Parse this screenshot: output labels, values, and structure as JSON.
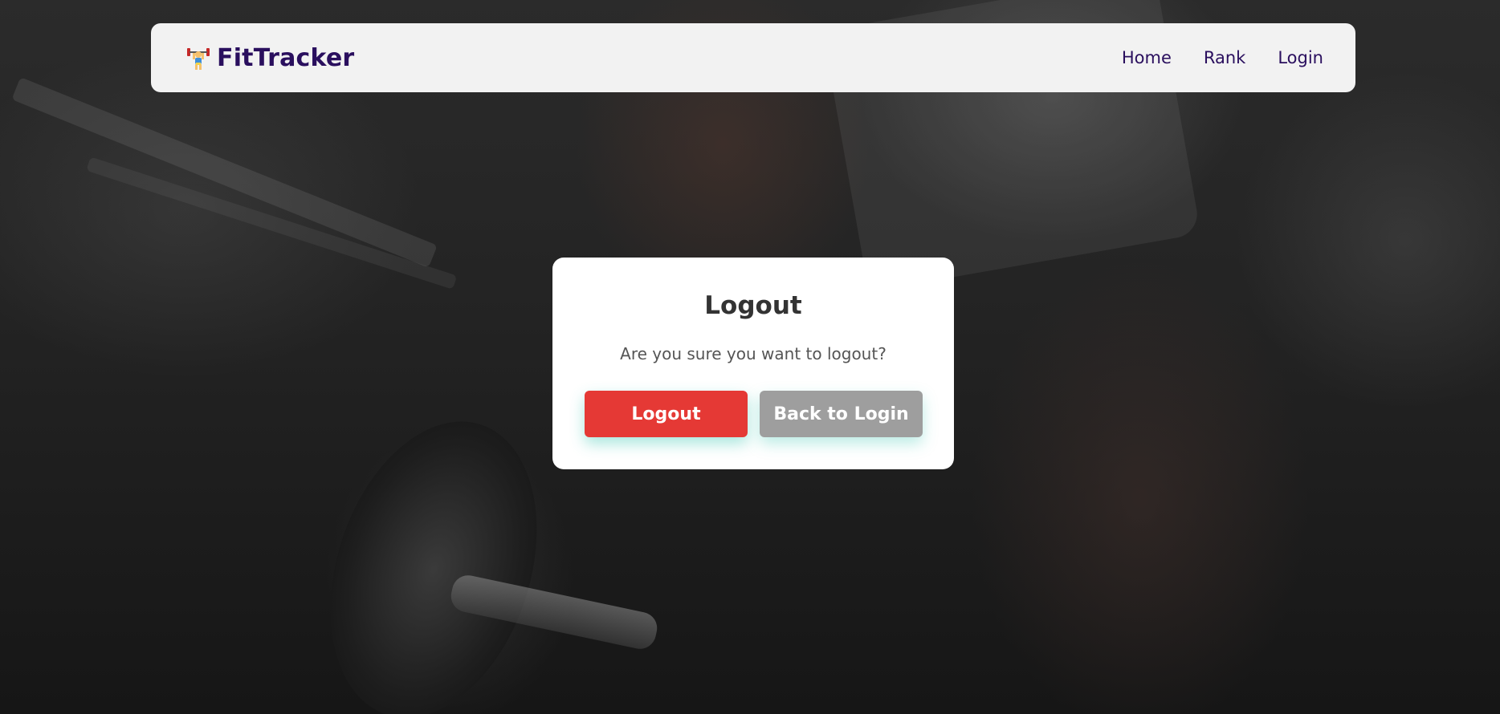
{
  "navbar": {
    "brand_icon": "weightlifter-icon",
    "brand_name": "FitTracker",
    "links": [
      {
        "label": "Home"
      },
      {
        "label": "Rank"
      },
      {
        "label": "Login"
      }
    ]
  },
  "dialog": {
    "title": "Logout",
    "message": "Are you sure you want to logout?",
    "logout_label": "Logout",
    "back_label": "Back to Login"
  },
  "colors": {
    "brand_text": "#2a0f5e",
    "navbar_bg": "#f2f2f2",
    "logout_button": "#e53935",
    "back_button": "#9e9e9e",
    "button_glow": "#40c8b4"
  },
  "background": {
    "image": "gym-dumbbell-photo"
  }
}
